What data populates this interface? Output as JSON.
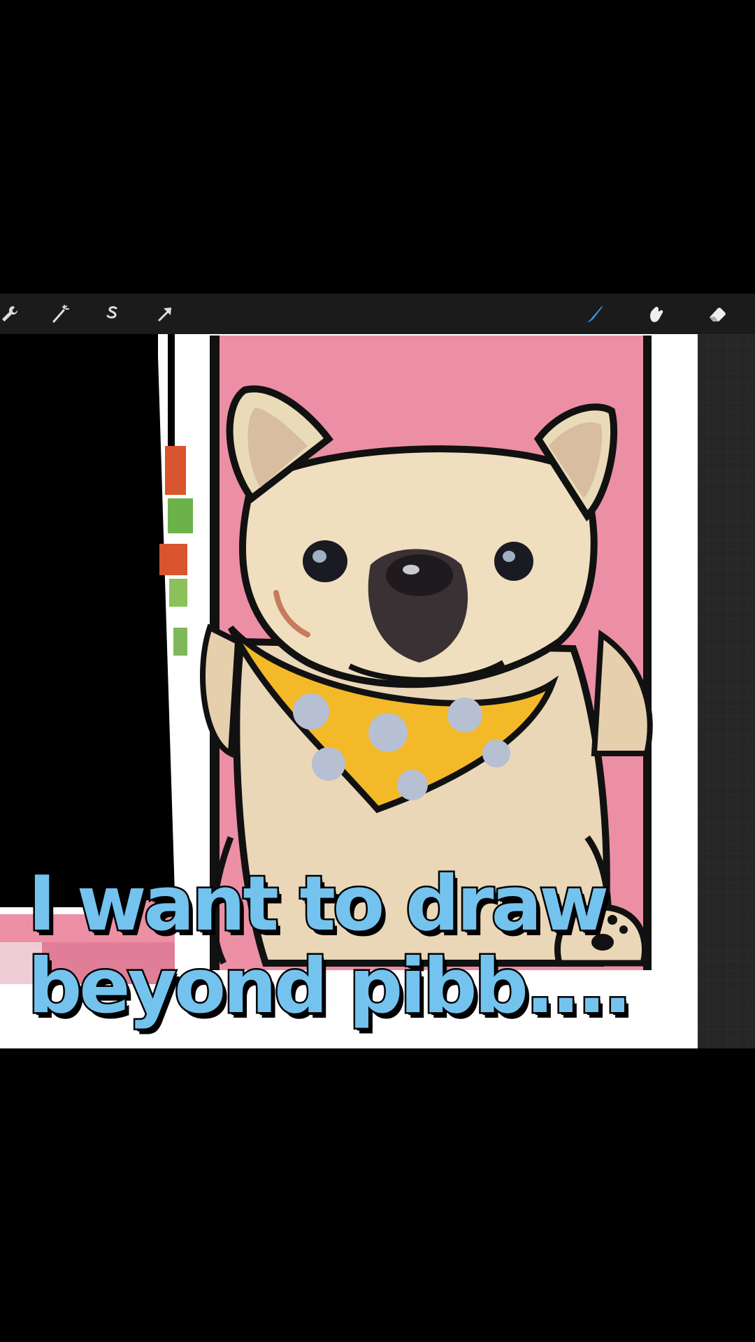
{
  "app": {
    "toolbar": {
      "left_tools": [
        {
          "name": "actions",
          "icon": "wrench-icon"
        },
        {
          "name": "adjustments",
          "icon": "magic-wand-icon"
        },
        {
          "name": "selection",
          "icon": "selection-s-icon"
        },
        {
          "name": "transform",
          "icon": "transform-arrow-icon"
        }
      ],
      "right_tools": [
        {
          "name": "brush",
          "icon": "brush-icon",
          "active": true
        },
        {
          "name": "smudge",
          "icon": "smudge-icon"
        },
        {
          "name": "eraser",
          "icon": "eraser-icon"
        }
      ],
      "accent_color": "#3b8fe8"
    }
  },
  "canvas": {
    "background_color": "#ec8fa5",
    "subject": "bulldog-illustration"
  },
  "caption": {
    "line1": "I want to draw",
    "line2": "beyond pibb....",
    "color": "#74c3ef"
  }
}
